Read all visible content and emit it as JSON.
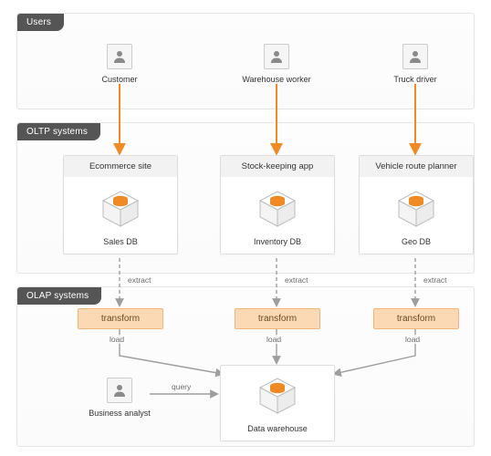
{
  "sections": {
    "users": "Users",
    "oltp": "OLTP systems",
    "olap": "OLAP systems"
  },
  "users": [
    {
      "role": "Customer"
    },
    {
      "role": "Warehouse worker"
    },
    {
      "role": "Truck driver"
    }
  ],
  "oltp_apps": [
    {
      "title": "Ecommerce site",
      "db": "Sales DB"
    },
    {
      "title": "Stock-keeping app",
      "db": "Inventory DB"
    },
    {
      "title": "Vehicle route planner",
      "db": "Geo DB"
    }
  ],
  "etl": {
    "step_label": "transform",
    "extract_label": "extract",
    "load_label": "load"
  },
  "warehouse": {
    "name": "Data warehouse"
  },
  "analyst": {
    "role": "Business analyst",
    "edge_label": "query"
  },
  "colors": {
    "accent_orange": "#f08a24",
    "transform_bg": "#fbd9b5",
    "transform_border": "#f0b57a",
    "band_label_bg": "#555555",
    "arrow_gray": "#9e9e9e"
  }
}
